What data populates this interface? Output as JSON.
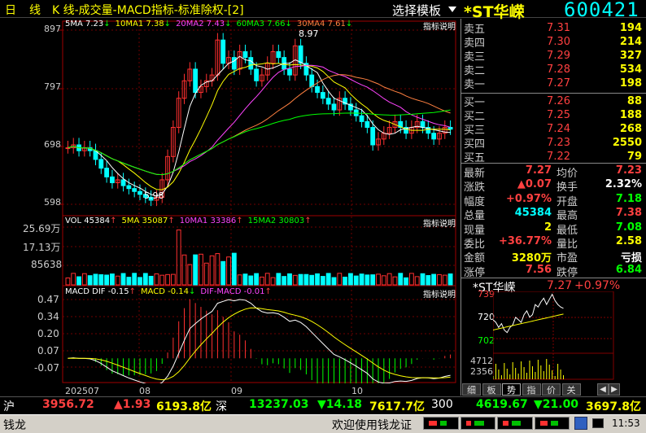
{
  "header": {
    "period_day": "日",
    "period_line": "线",
    "title": "K 线-成交量-MACD指标-标准除权-[2]",
    "template_button": "选择模板",
    "stock_name": "*ST华嵘",
    "stock_code": "600421"
  },
  "kline": {
    "indicator_link": "指标说明",
    "legend": [
      {
        "label": "5MA 7.23",
        "arrow": "↓",
        "color": "#ffffff"
      },
      {
        "label": "10MA1 7.38",
        "arrow": "↓",
        "color": "#ffff00"
      },
      {
        "label": "20MA2 7.43",
        "arrow": "↓",
        "color": "#ff44ff"
      },
      {
        "label": "60MA3 7.66",
        "arrow": "↓",
        "color": "#00ff00"
      },
      {
        "label": "30MA4 7.61",
        "arrow": "↓",
        "color": "#ff8040"
      }
    ],
    "y_labels": [
      "897",
      "797",
      "698",
      "598"
    ],
    "high_mark": "8.97",
    "low_mark": "5.98"
  },
  "volume": {
    "indicator_link": "指标说明",
    "legend": [
      {
        "label": "VOL 45384",
        "arrow": "↑",
        "color": "#ffffff"
      },
      {
        "label": "5MA 35087",
        "arrow": "↑",
        "color": "#ffff00"
      },
      {
        "label": "10MA1 33386",
        "arrow": "↑",
        "color": "#ff44ff"
      },
      {
        "label": "15MA2 30803",
        "arrow": "↑",
        "color": "#00ff00"
      }
    ],
    "y_labels": [
      "25.69万",
      "17.13万",
      "85638"
    ]
  },
  "macd": {
    "indicator_link": "指标说明",
    "legend": [
      {
        "label": "MACD DIF -0.15",
        "arrow": "↑",
        "color": "#ffffff"
      },
      {
        "label": "MACD -0.14",
        "arrow": "↓",
        "color": "#ffff00"
      },
      {
        "label": "DIF-MACD -0.01",
        "arrow": "↑",
        "color": "#ff44ff"
      }
    ],
    "y_labels": [
      "0.47",
      "0.34",
      "0.20",
      "0.07",
      "-0.07"
    ]
  },
  "x_axis": [
    "202507",
    "08",
    "09",
    "10"
  ],
  "quotes": {
    "sell": [
      {
        "label": "卖五",
        "price": "7.31",
        "volume": "194"
      },
      {
        "label": "卖四",
        "price": "7.30",
        "volume": "214"
      },
      {
        "label": "卖三",
        "price": "7.29",
        "volume": "327"
      },
      {
        "label": "卖二",
        "price": "7.28",
        "volume": "534"
      },
      {
        "label": "卖一",
        "price": "7.27",
        "volume": "198"
      }
    ],
    "buy": [
      {
        "label": "买一",
        "price": "7.26",
        "volume": "88"
      },
      {
        "label": "买二",
        "price": "7.25",
        "volume": "188"
      },
      {
        "label": "买三",
        "price": "7.24",
        "volume": "268"
      },
      {
        "label": "买四",
        "price": "7.23",
        "volume": "2550"
      },
      {
        "label": "买五",
        "price": "7.22",
        "volume": "79"
      }
    ]
  },
  "stats": [
    {
      "l1": "最新",
      "v1": "7.27",
      "c1": "#ff4040",
      "l2": "均价",
      "v2": "7.23",
      "c2": "#ff4040"
    },
    {
      "l1": "涨跌",
      "v1": "▲0.07",
      "c1": "#ff4040",
      "l2": "换手",
      "v2": "2.32%",
      "c2": "#ffffff"
    },
    {
      "l1": "幅度",
      "v1": "+0.97%",
      "c1": "#ff4040",
      "l2": "开盘",
      "v2": "7.18",
      "c2": "#00ff00"
    },
    {
      "l1": "总量",
      "v1": "45384",
      "c1": "#00ffff",
      "l2": "最高",
      "v2": "7.38",
      "c2": "#ff4040"
    },
    {
      "l1": "现量",
      "v1": "2",
      "c1": "#ffff00",
      "l2": "最低",
      "v2": "7.08",
      "c2": "#00ff00"
    },
    {
      "l1": "委比",
      "v1": "+36.77%",
      "c1": "#ff4040",
      "l2": "量比",
      "v2": "2.58",
      "c2": "#ffff00"
    },
    {
      "l1": "金额",
      "v1": "3280万",
      "c1": "#ffff00",
      "l2": "市盈",
      "v2": "亏损",
      "c2": "#ffffff"
    },
    {
      "l1": "涨停",
      "v1": "7.56",
      "c1": "#ff4040",
      "l2": "跌停",
      "v2": "6.84",
      "c2": "#00ff00"
    }
  ],
  "mini_chart": {
    "name": "*ST华嵘",
    "price": "7.27",
    "change": "+0.97%",
    "y_labels": [
      "739",
      "720",
      "702"
    ],
    "vol_labels": [
      "4712",
      "2356"
    ]
  },
  "tabs": [
    "细",
    "板",
    "势",
    "指",
    "价",
    "关"
  ],
  "active_tab": "势",
  "index_bar": {
    "sh_label": "沪",
    "sh_value": "3956.72",
    "sh_change": "▲1.93",
    "sh_amount": "6193.8亿",
    "sz_label": "深",
    "sz_value": "13237.03",
    "sz_change": "▼14.18",
    "sz_amount": "7617.7亿",
    "cy_label": "300",
    "cy_value": "4619.67",
    "cy_change": "▼21.00",
    "cy_amount": "3697.8亿"
  },
  "status_bar": {
    "app_name": "钱龙",
    "welcome": "欢迎使用钱龙证",
    "time": "11:53"
  },
  "chart_data": [
    {
      "type": "candlestick",
      "title": "K 线",
      "x": [
        "202507",
        "08",
        "09",
        "10"
      ],
      "ylim": [
        5.98,
        8.97
      ],
      "series": [
        {
          "name": "5MA",
          "last": 7.23
        },
        {
          "name": "10MA1",
          "last": 7.38
        },
        {
          "name": "20MA2",
          "last": 7.43
        },
        {
          "name": "60MA3",
          "last": 7.66
        },
        {
          "name": "30MA4",
          "last": 7.61
        }
      ]
    },
    {
      "type": "bar",
      "title": "VOL",
      "series": [
        {
          "name": "VOL",
          "last": 45384
        },
        {
          "name": "5MA",
          "last": 35087
        },
        {
          "name": "10MA1",
          "last": 33386
        },
        {
          "name": "15MA2",
          "last": 30803
        }
      ]
    },
    {
      "type": "line",
      "title": "MACD",
      "ylim": [
        -0.07,
        0.47
      ],
      "series": [
        {
          "name": "DIF",
          "last": -0.15
        },
        {
          "name": "MACD",
          "last": -0.14
        },
        {
          "name": "DIF-MACD",
          "last": -0.01
        }
      ]
    }
  ]
}
